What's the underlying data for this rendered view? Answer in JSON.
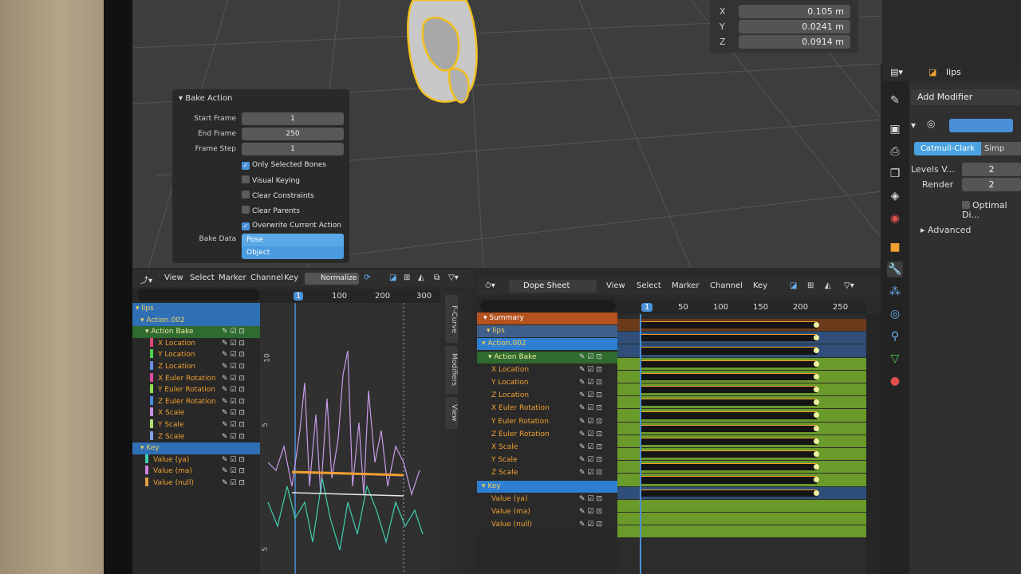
{
  "viewport": {
    "dimensions": [
      {
        "label": "X",
        "value": "0.105 m"
      },
      {
        "label": "Y",
        "value": "0.0241 m"
      },
      {
        "label": "Z",
        "value": "0.0914 m"
      }
    ]
  },
  "bake_action": {
    "title": "Bake Action",
    "start_frame_label": "Start Frame",
    "start_frame": "1",
    "end_frame_label": "End Frame",
    "end_frame": "250",
    "frame_step_label": "Frame Step",
    "frame_step": "1",
    "options": [
      {
        "label": "Only Selected Bones",
        "checked": true
      },
      {
        "label": "Visual Keying",
        "checked": false
      },
      {
        "label": "Clear Constraints",
        "checked": false
      },
      {
        "label": "Clear Parents",
        "checked": false
      },
      {
        "label": "Overwrite Current Action",
        "checked": true
      }
    ],
    "bake_data_label": "Bake Data",
    "bake_data_options": [
      "Pose",
      "Object"
    ]
  },
  "properties": {
    "object_name": "lips",
    "add_modifier": "Add Modifier",
    "subdiv_mode": "Catmull-Clark",
    "subdiv_mode_other": "Simp",
    "levels_label": "Levels V...",
    "levels_value": "2",
    "render_label": "Render",
    "render_value": "2",
    "optimal_label": "Optimal Di...",
    "advanced_label": "Advanced"
  },
  "graph_editor": {
    "menus": [
      "View",
      "Select",
      "Marker",
      "Channel",
      "Key"
    ],
    "normalize_label": "Normalize",
    "ruler_ticks": [
      "1",
      "100",
      "200",
      "300"
    ],
    "y_ticks": [
      "10",
      "5",
      "5"
    ],
    "channels": [
      {
        "label": "lips",
        "level": 0,
        "kind": "object"
      },
      {
        "label": "Action.002",
        "level": 1,
        "kind": "action"
      },
      {
        "label": "Action Bake",
        "level": 2,
        "kind": "group"
      },
      {
        "label": "X Location",
        "level": 3,
        "color": "#e0487a"
      },
      {
        "label": "Y Location",
        "level": 3,
        "color": "#4cd44c"
      },
      {
        "label": "Z Location",
        "level": 3,
        "color": "#6a8ee6"
      },
      {
        "label": "X Euler Rotation",
        "level": 3,
        "color": "#e04aa0"
      },
      {
        "label": "Y Euler Rotation",
        "level": 3,
        "color": "#8fe04a"
      },
      {
        "label": "Z Euler Rotation",
        "level": 3,
        "color": "#4a8ee0"
      },
      {
        "label": "X Scale",
        "level": 3,
        "color": "#c890e0"
      },
      {
        "label": "Y Scale",
        "level": 3,
        "color": "#b0e070"
      },
      {
        "label": "Z Scale",
        "level": 3,
        "color": "#80a0e0"
      },
      {
        "label": "Key",
        "level": 1,
        "kind": "action"
      },
      {
        "label": "Value (ya)",
        "level": 2,
        "color": "#40d0b0"
      },
      {
        "label": "Value (ma)",
        "level": 2,
        "color": "#d080e0"
      },
      {
        "label": "Value (null)",
        "level": 2,
        "color": "#e0a040"
      }
    ],
    "side_tabs": [
      "F-Curve",
      "Modifiers",
      "View"
    ]
  },
  "dope_sheet": {
    "mode": "Dope Sheet",
    "menus": [
      "View",
      "Select",
      "Marker",
      "Channel",
      "Key"
    ],
    "ruler_ticks": [
      "1",
      "50",
      "100",
      "150",
      "200",
      "250"
    ],
    "channels": [
      {
        "label": "Summary",
        "kind": "summary"
      },
      {
        "label": "lips",
        "kind": "object"
      },
      {
        "label": "Action.002",
        "kind": "action"
      },
      {
        "label": "Action Bake",
        "kind": "group"
      },
      {
        "label": "X Location",
        "kind": "fcurve"
      },
      {
        "label": "Y Location",
        "kind": "fcurve"
      },
      {
        "label": "Z Location",
        "kind": "fcurve"
      },
      {
        "label": "X Euler Rotation",
        "kind": "fcurve"
      },
      {
        "label": "Y Euler Rotation",
        "kind": "fcurve"
      },
      {
        "label": "Z Euler Rotation",
        "kind": "fcurve"
      },
      {
        "label": "X Scale",
        "kind": "fcurve"
      },
      {
        "label": "Y Scale",
        "kind": "fcurve"
      },
      {
        "label": "Z Scale",
        "kind": "fcurve"
      },
      {
        "label": "Key",
        "kind": "action"
      },
      {
        "label": "Value (ya)",
        "kind": "fcurve"
      },
      {
        "label": "Value (ma)",
        "kind": "fcurve"
      },
      {
        "label": "Value (null)",
        "kind": "fcurve"
      }
    ]
  },
  "colors": {
    "accent": "#4a90d9",
    "selected_blue": "#2f7fd1",
    "summary_orange": "#b5521e",
    "group_green": "#2f6a2f",
    "track_green": "#6a9a2a",
    "keyframe_orange": "#f0a030",
    "outline_yellow": "#f0c020"
  }
}
